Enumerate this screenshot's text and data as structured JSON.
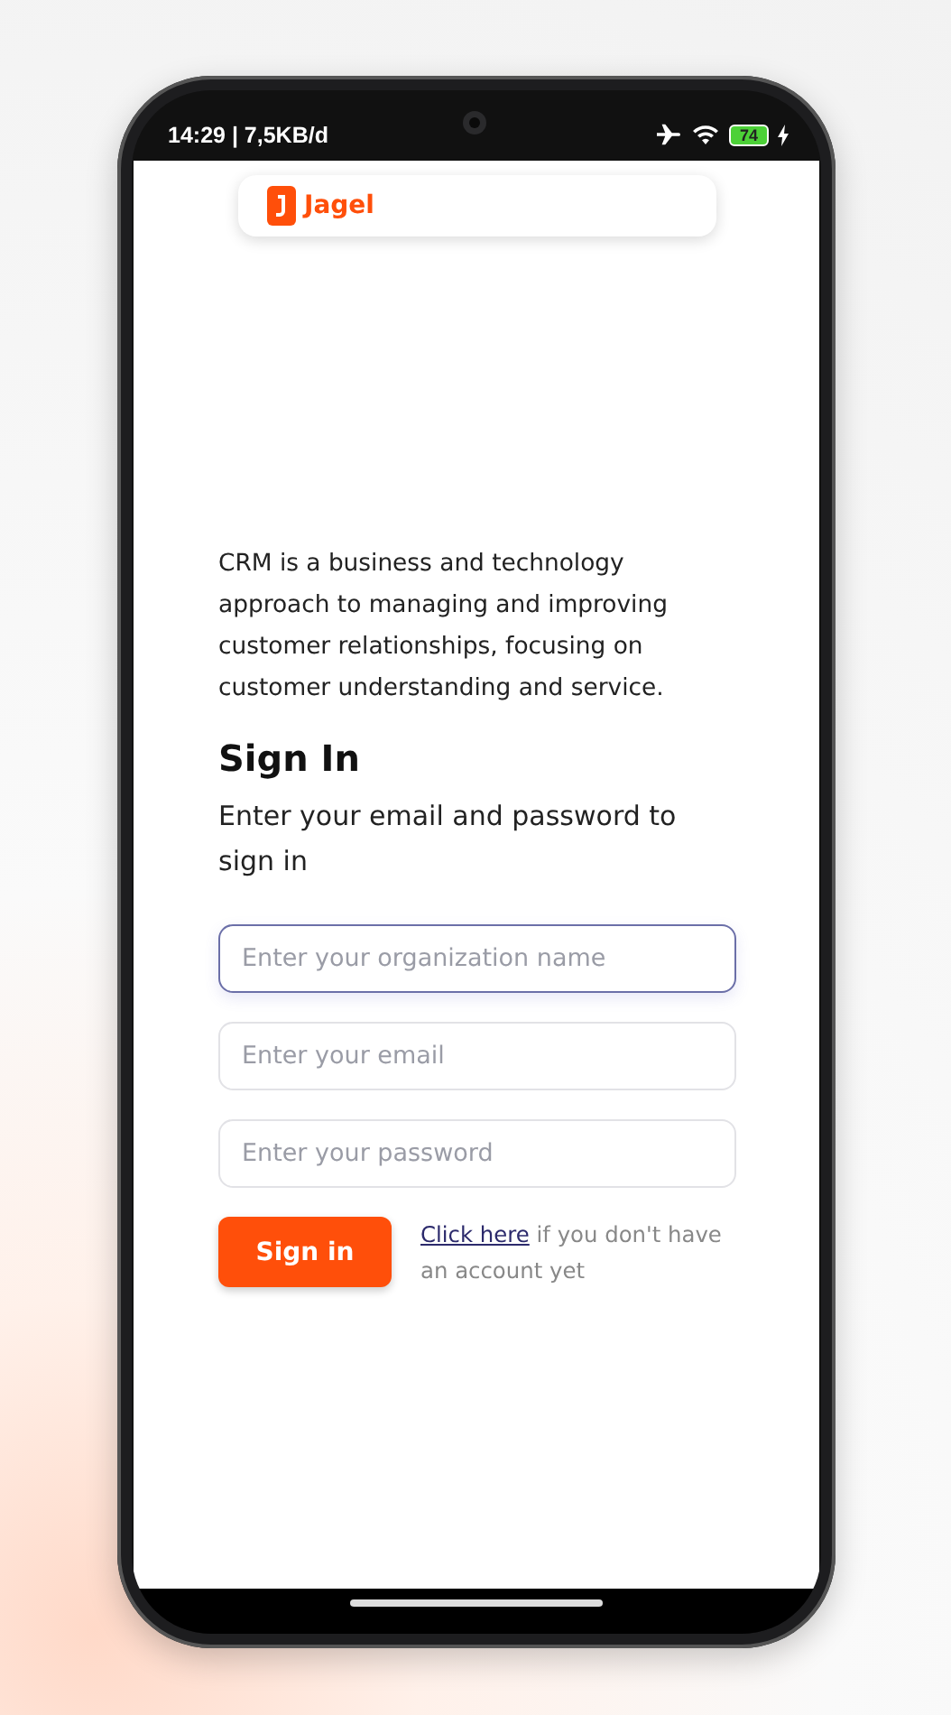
{
  "status_bar": {
    "time_and_speed": "14:29 | 7,5KB/d",
    "battery": "74"
  },
  "logo": {
    "name": "Jagel"
  },
  "intro": "CRM is a business and technology approach to managing and improving customer relationships, focusing on customer understanding and service.",
  "title": "Sign In",
  "subtitle": "Enter your email and password to sign in",
  "fields": [
    {
      "placeholder": "Enter your organization name",
      "focused": true
    },
    {
      "placeholder": "Enter your email",
      "focused": false
    },
    {
      "placeholder": "Enter your password",
      "focused": false
    }
  ],
  "sign_in_button": "Sign in",
  "signup_link": "Click here",
  "signup_text": "if you don't have an account yet"
}
